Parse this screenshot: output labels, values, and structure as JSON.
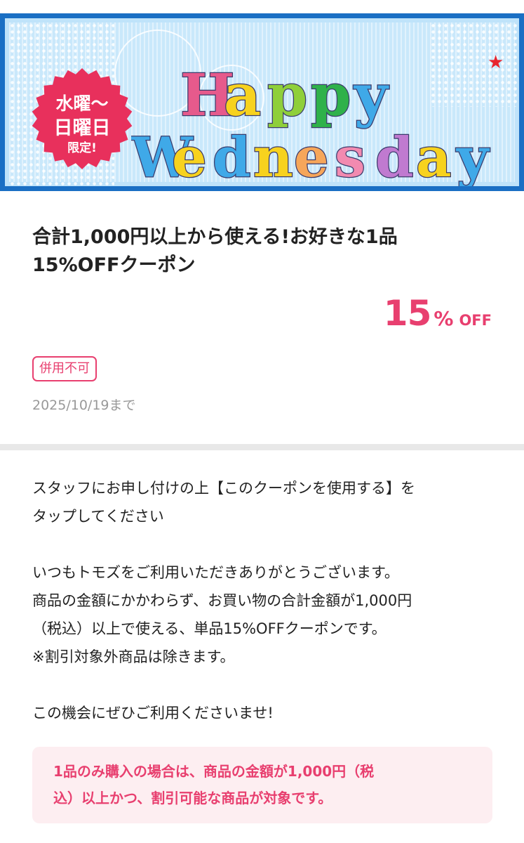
{
  "banner": {
    "badge_line1": "水曜〜",
    "badge_line2": "日曜日",
    "badge_line3": "限定!",
    "logo_line1": [
      {
        "ch": "H",
        "color": "#e65a8c"
      },
      {
        "ch": "a",
        "color": "#f7d21e"
      },
      {
        "ch": "p",
        "color": "#8fcf3a"
      },
      {
        "ch": "p",
        "color": "#2fb14a"
      },
      {
        "ch": "y",
        "color": "#3fa9e8"
      }
    ],
    "logo_line2": [
      {
        "ch": "W",
        "color": "#3fa9e8"
      },
      {
        "ch": "e",
        "color": "#f7d21e"
      },
      {
        "ch": "d",
        "color": "#3fa9e8"
      },
      {
        "ch": "n",
        "color": "#f7d21e"
      },
      {
        "ch": "e",
        "color": "#f6a65a"
      },
      {
        "ch": "s",
        "color": "#f28ab0"
      },
      {
        "ch": "d",
        "color": "#c07ad0"
      },
      {
        "ch": "a",
        "color": "#f7d21e"
      },
      {
        "ch": "y",
        "color": "#3fa9e8"
      }
    ],
    "star_icon": "star-icon",
    "colors": {
      "frame": "#1a6fc4",
      "background": "#c9e8fb",
      "badge": "#e8305c",
      "star": "#e8252e"
    }
  },
  "coupon": {
    "title": "合計1,000円以上から使える!お好きな1品\n15%OFFクーポン",
    "discount_value": "15",
    "discount_percent": "%",
    "discount_off": "OFF",
    "tag": "併用不可",
    "expiry": "2025/10/19まで",
    "accent_color": "#e83f6f"
  },
  "description": {
    "para1": "スタッフにお申し付けの上【このクーポンを使用する】を\nタップしてください",
    "para2": "いつもトモズをご利用いただきありがとうございます。\n商品の金額にかかわらず、お買い物の合計金額が1,000円\n（税込）以上で使える、単品15%OFFクーポンです。\n※割引対象外商品は除きます。",
    "para3": "この機会にぜひご利用くださいませ!"
  },
  "notice": {
    "text": "1品のみ購入の場合は、商品の金額が1,000円（税\n込）以上かつ、割引可能な商品が対象です。"
  }
}
